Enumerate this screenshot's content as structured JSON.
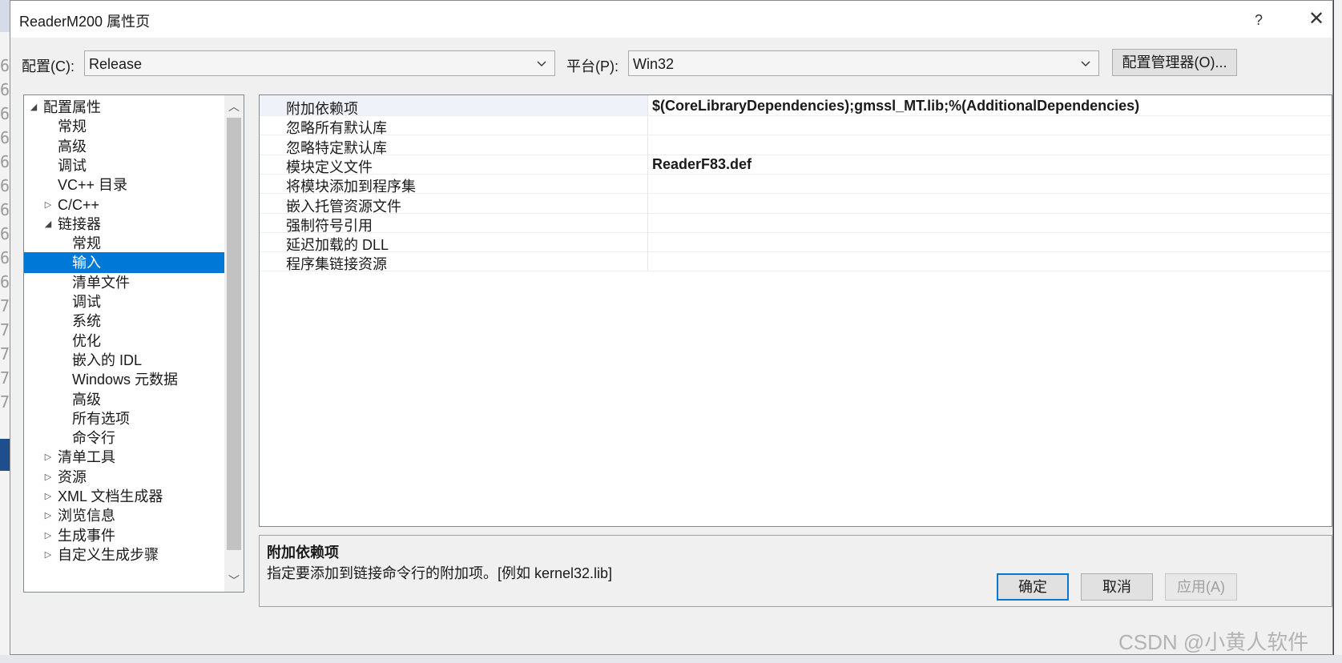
{
  "window": {
    "title": "ReaderM200 属性页",
    "help_glyph": "?",
    "close_glyph": "✕"
  },
  "toolbar": {
    "config_label": "配置(C):",
    "config_value": "Release",
    "platform_label": "平台(P):",
    "platform_value": "Win32",
    "config_manager_label": "配置管理器(O)..."
  },
  "tree": {
    "items": [
      {
        "label": "配置属性",
        "level": 0,
        "expander": "expanded"
      },
      {
        "label": "常规",
        "level": 1,
        "expander": "none"
      },
      {
        "label": "高级",
        "level": 1,
        "expander": "none"
      },
      {
        "label": "调试",
        "level": 1,
        "expander": "none"
      },
      {
        "label": "VC++ 目录",
        "level": 1,
        "expander": "none"
      },
      {
        "label": "C/C++",
        "level": 1,
        "expander": "collapsed"
      },
      {
        "label": "链接器",
        "level": 1,
        "expander": "expanded"
      },
      {
        "label": "常规",
        "level": 2,
        "expander": "none"
      },
      {
        "label": "输入",
        "level": 2,
        "expander": "none",
        "selected": true
      },
      {
        "label": "清单文件",
        "level": 2,
        "expander": "none"
      },
      {
        "label": "调试",
        "level": 2,
        "expander": "none"
      },
      {
        "label": "系统",
        "level": 2,
        "expander": "none"
      },
      {
        "label": "优化",
        "level": 2,
        "expander": "none"
      },
      {
        "label": "嵌入的 IDL",
        "level": 2,
        "expander": "none"
      },
      {
        "label": "Windows 元数据",
        "level": 2,
        "expander": "none"
      },
      {
        "label": "高级",
        "level": 2,
        "expander": "none"
      },
      {
        "label": "所有选项",
        "level": 2,
        "expander": "none"
      },
      {
        "label": "命令行",
        "level": 2,
        "expander": "none"
      },
      {
        "label": "清单工具",
        "level": 1,
        "expander": "collapsed"
      },
      {
        "label": "资源",
        "level": 1,
        "expander": "collapsed"
      },
      {
        "label": "XML 文档生成器",
        "level": 1,
        "expander": "collapsed"
      },
      {
        "label": "浏览信息",
        "level": 1,
        "expander": "collapsed"
      },
      {
        "label": "生成事件",
        "level": 1,
        "expander": "collapsed"
      },
      {
        "label": "自定义生成步骤",
        "level": 1,
        "expander": "collapsed"
      }
    ]
  },
  "properties": {
    "rows": [
      {
        "name": "附加依赖项",
        "value": "$(CoreLibraryDependencies);gmssl_MT.lib;%(AdditionalDependencies)"
      },
      {
        "name": "忽略所有默认库",
        "value": ""
      },
      {
        "name": "忽略特定默认库",
        "value": ""
      },
      {
        "name": "模块定义文件",
        "value": "ReaderF83.def"
      },
      {
        "name": "将模块添加到程序集",
        "value": ""
      },
      {
        "name": "嵌入托管资源文件",
        "value": ""
      },
      {
        "name": "强制符号引用",
        "value": ""
      },
      {
        "name": "延迟加载的 DLL",
        "value": ""
      },
      {
        "name": "程序集链接资源",
        "value": ""
      }
    ]
  },
  "description": {
    "title": "附加依赖项",
    "text": "指定要添加到链接命令行的附加项。[例如 kernel32.lib]"
  },
  "buttons": {
    "ok": "确定",
    "cancel": "取消",
    "apply": "应用(A)"
  },
  "background": {
    "line_digits": [
      "6",
      "6",
      "6",
      "6",
      "6",
      "6",
      "6",
      "6",
      "6",
      "6",
      "7",
      "7",
      "7",
      "7",
      "7"
    ]
  },
  "watermark": "CSDN @小黄人软件",
  "colors": {
    "selection": "#0078d7",
    "dialog_bg": "#f0f0f0"
  }
}
